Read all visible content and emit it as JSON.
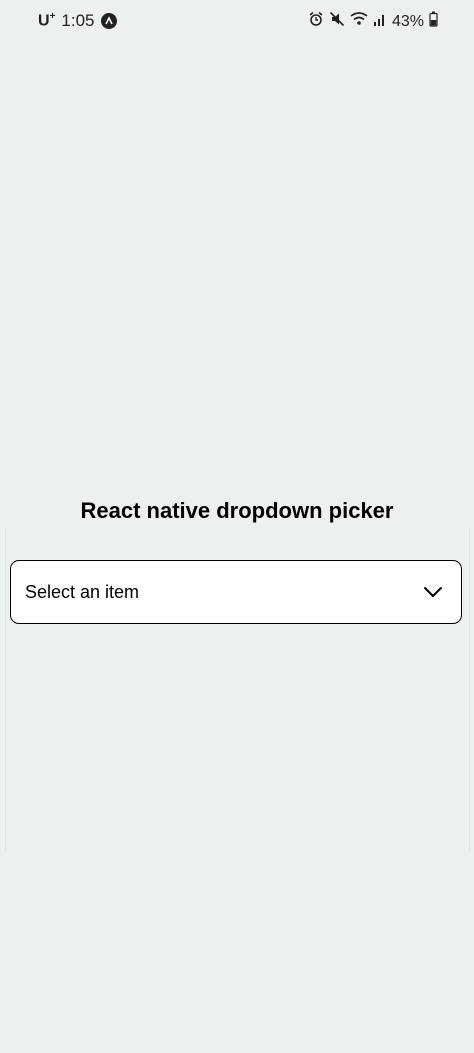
{
  "status_bar": {
    "carrier": "U",
    "carrier_sup": "+",
    "time": "1:05",
    "battery_percent": "43%",
    "icons": [
      "notification-a-icon",
      "alarm-icon",
      "mute-icon",
      "wifi-icon",
      "signal-icon",
      "battery-icon"
    ]
  },
  "screen": {
    "title": "React native dropdown picker",
    "dropdown": {
      "placeholder": "Select an item",
      "icon": "chevron-down-icon"
    }
  },
  "colors": {
    "background": "#ecf0f1",
    "dropdown_bg": "#ffffff",
    "border": "#000000"
  }
}
